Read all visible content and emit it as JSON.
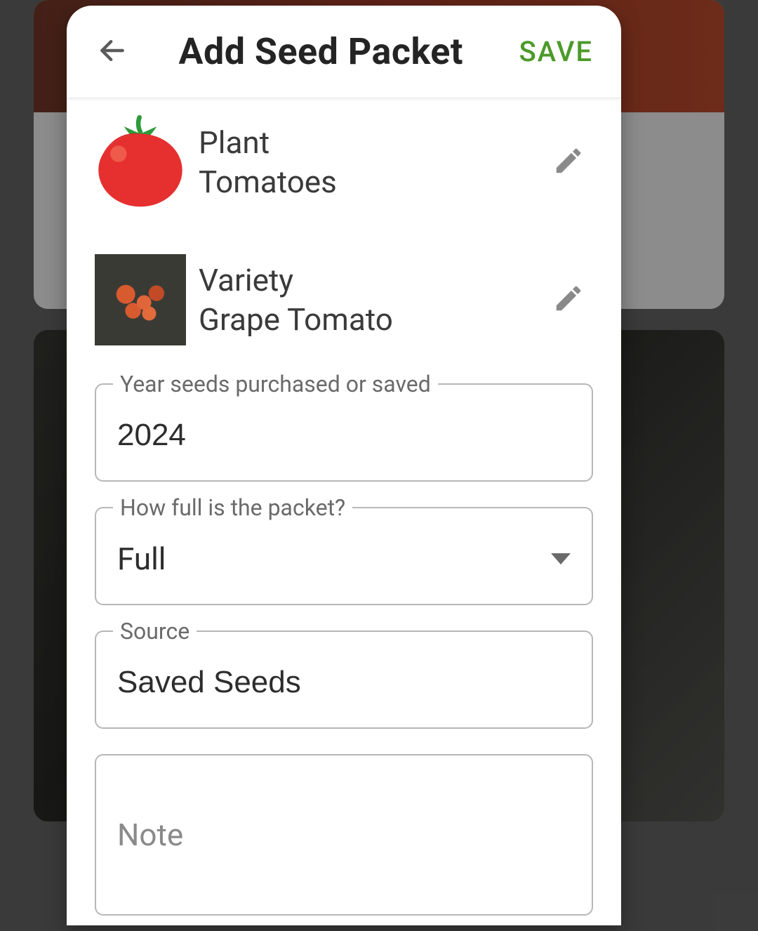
{
  "header": {
    "title": "Add Seed Packet",
    "save_label": "SAVE"
  },
  "plant": {
    "label": "Plant",
    "value": "Tomatoes"
  },
  "variety": {
    "label": "Variety",
    "value": "Grape Tomato"
  },
  "fields": {
    "year": {
      "label": "Year seeds purchased or saved",
      "value": "2024"
    },
    "fullness": {
      "label": "How full is the packet?",
      "value": "Full"
    },
    "source": {
      "label": "Source",
      "value": "Saved Seeds"
    },
    "note": {
      "placeholder": "Note",
      "value": ""
    }
  },
  "colors": {
    "accent": "#4c9a2a",
    "tomato_body": "#e62f2f",
    "tomato_highlight": "#ef5b4a",
    "tomato_stem": "#2e9a3a"
  }
}
